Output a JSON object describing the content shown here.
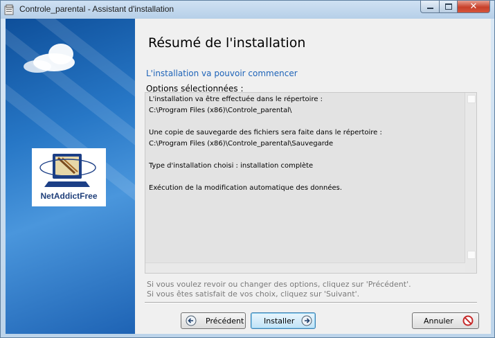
{
  "window": {
    "title": "Controle_parental - Assistant d'installation",
    "close_glyph": "✕",
    "icons": {
      "app": "installer-icon",
      "minimize": "minimize-icon",
      "maximize": "maximize-icon",
      "close": "close-icon"
    }
  },
  "sidebar": {
    "logo_text": "NetAddictFree",
    "logo_icon": "computer-monitor-logo"
  },
  "page": {
    "heading": "Résumé de l'installation",
    "subtitle": "L'installation va pouvoir commencer",
    "options_label": "Options sélectionnées :",
    "summary_lines": [
      "L'installation va être effectuée dans le répertoire :",
      "C:\\Program Files (x86)\\Controle_parental\\",
      "",
      "Une copie de sauvegarde des fichiers sera faite dans le répertoire :",
      "C:\\Program Files (x86)\\Controle_parental\\Sauvegarde",
      "",
      "Type d'installation choisi : installation complète",
      "",
      "Exécution de la modification automatique des données."
    ],
    "hint_lines": [
      "Si vous voulez revoir ou changer des options, cliquez sur 'Précédent'.",
      "Si vous êtes satisfait de vos choix, cliquez sur 'Suivant'."
    ]
  },
  "buttons": {
    "previous": "Précédent",
    "install": "Installer",
    "cancel": "Annuler",
    "icons": {
      "previous": "arrow-left-icon",
      "install": "arrow-right-icon",
      "cancel": "cancel-icon"
    }
  },
  "colors": {
    "accent": "#1d63b8",
    "sidebar": "#2777c6",
    "close_button": "#c7402a"
  }
}
